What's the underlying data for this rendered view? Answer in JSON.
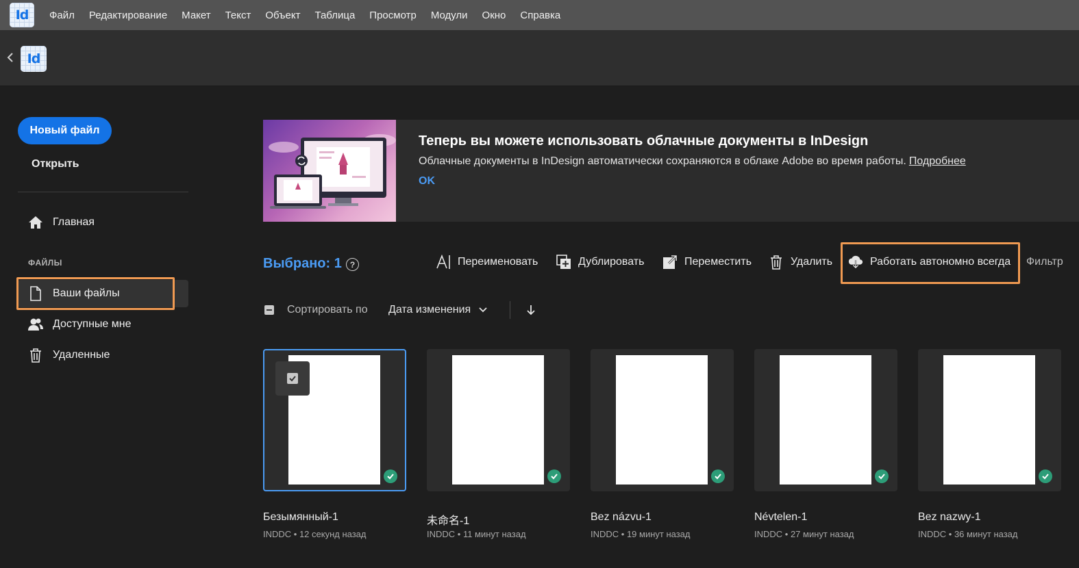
{
  "app": {
    "logo_text": "Id"
  },
  "menu": [
    "Файл",
    "Редактирование",
    "Макет",
    "Текст",
    "Объект",
    "Таблица",
    "Просмотр",
    "Модули",
    "Окно",
    "Справка"
  ],
  "sidebar": {
    "new_file": "Новый файл",
    "open": "Открыть",
    "home": "Главная",
    "section_files": "ФАЙЛЫ",
    "your_files": "Ваши файлы",
    "shared": "Доступные мне",
    "deleted": "Удаленные"
  },
  "banner": {
    "title": "Теперь вы можете использовать облачные документы в InDesign",
    "description": "Облачные документы в InDesign автоматически сохраняются в облаке Adobe во время работы.",
    "learn_more": "Подробнее",
    "ok": "OK"
  },
  "toolbar": {
    "selected": "Выбрано: 1",
    "help": "?",
    "rename": "Переименовать",
    "duplicate": "Дублировать",
    "move": "Переместить",
    "delete": "Удалить",
    "offline": "Работать автономно всегда",
    "filter": "Фильтр"
  },
  "sort": {
    "label": "Сортировать по",
    "value": "Дата изменения"
  },
  "files": [
    {
      "name": "Безымянный-1",
      "meta": "INDDC • 12 секунд назад",
      "selected": true
    },
    {
      "name": "未命名-1",
      "meta": "INDDC • 11 минут назад",
      "selected": false
    },
    {
      "name": "Bez názvu-1",
      "meta": "INDDC • 19 минут назад",
      "selected": false
    },
    {
      "name": "Névtelen-1",
      "meta": "INDDC • 27 минут назад",
      "selected": false
    },
    {
      "name": "Bez nazwy-1",
      "meta": "INDDC • 36 минут назад",
      "selected": false
    }
  ],
  "colors": {
    "accent": "#1473e6",
    "link": "#4b9cf5",
    "highlight": "#f09a52",
    "synced": "#2d9d78"
  }
}
